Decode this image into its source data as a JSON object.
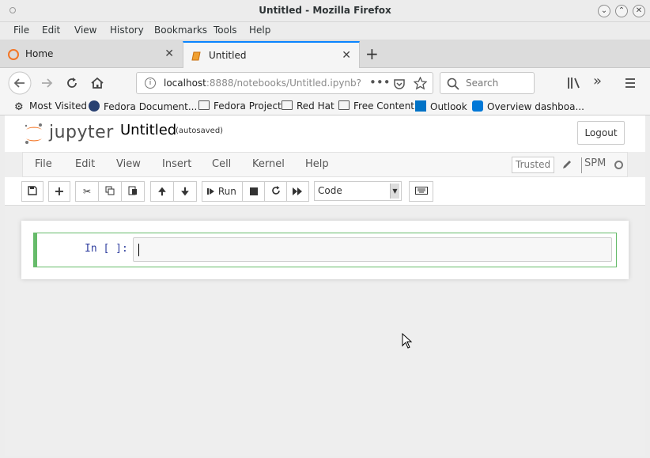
{
  "window": {
    "title": "Untitled - Mozilla Firefox"
  },
  "menubar": [
    "File",
    "Edit",
    "View",
    "History",
    "Bookmarks",
    "Tools",
    "Help"
  ],
  "tabs": [
    {
      "label": "Home",
      "active": false
    },
    {
      "label": "Untitled",
      "active": true
    }
  ],
  "navbar": {
    "url_host": "localhost",
    "url_rest": ":8888/notebooks/Untitled.ipynb?k",
    "search_placeholder": "Search"
  },
  "bookmarks": [
    {
      "label": "Most Visited",
      "icon": "gear-icon"
    },
    {
      "label": "Fedora Document...",
      "icon": "fedora-icon"
    },
    {
      "label": "Fedora Project",
      "icon": "folder-icon"
    },
    {
      "label": "Red Hat",
      "icon": "folder-icon"
    },
    {
      "label": "Free Content",
      "icon": "folder-icon"
    },
    {
      "label": "Outlook",
      "icon": "outlook-icon"
    },
    {
      "label": "Overview dashboa...",
      "icon": "azure-devops-icon"
    }
  ],
  "jupyter": {
    "logo_text": "jupyter",
    "notebook_title": "Untitled",
    "autosave_status": "(autosaved)",
    "logout_label": "Logout",
    "menu": [
      "File",
      "Edit",
      "View",
      "Insert",
      "Cell",
      "Kernel",
      "Help"
    ],
    "trusted_label": "Trusted",
    "kernel_name": "SPM",
    "toolbar": {
      "run_label": "Run",
      "cell_type": "Code"
    },
    "cell": {
      "prompt": "In [ ]:",
      "source": ""
    }
  },
  "colors": {
    "accent_tab": "#0a84ff",
    "cell_border": "#66bb6a",
    "prompt": "#303f9f",
    "jupyter_orange": "#f37626"
  }
}
